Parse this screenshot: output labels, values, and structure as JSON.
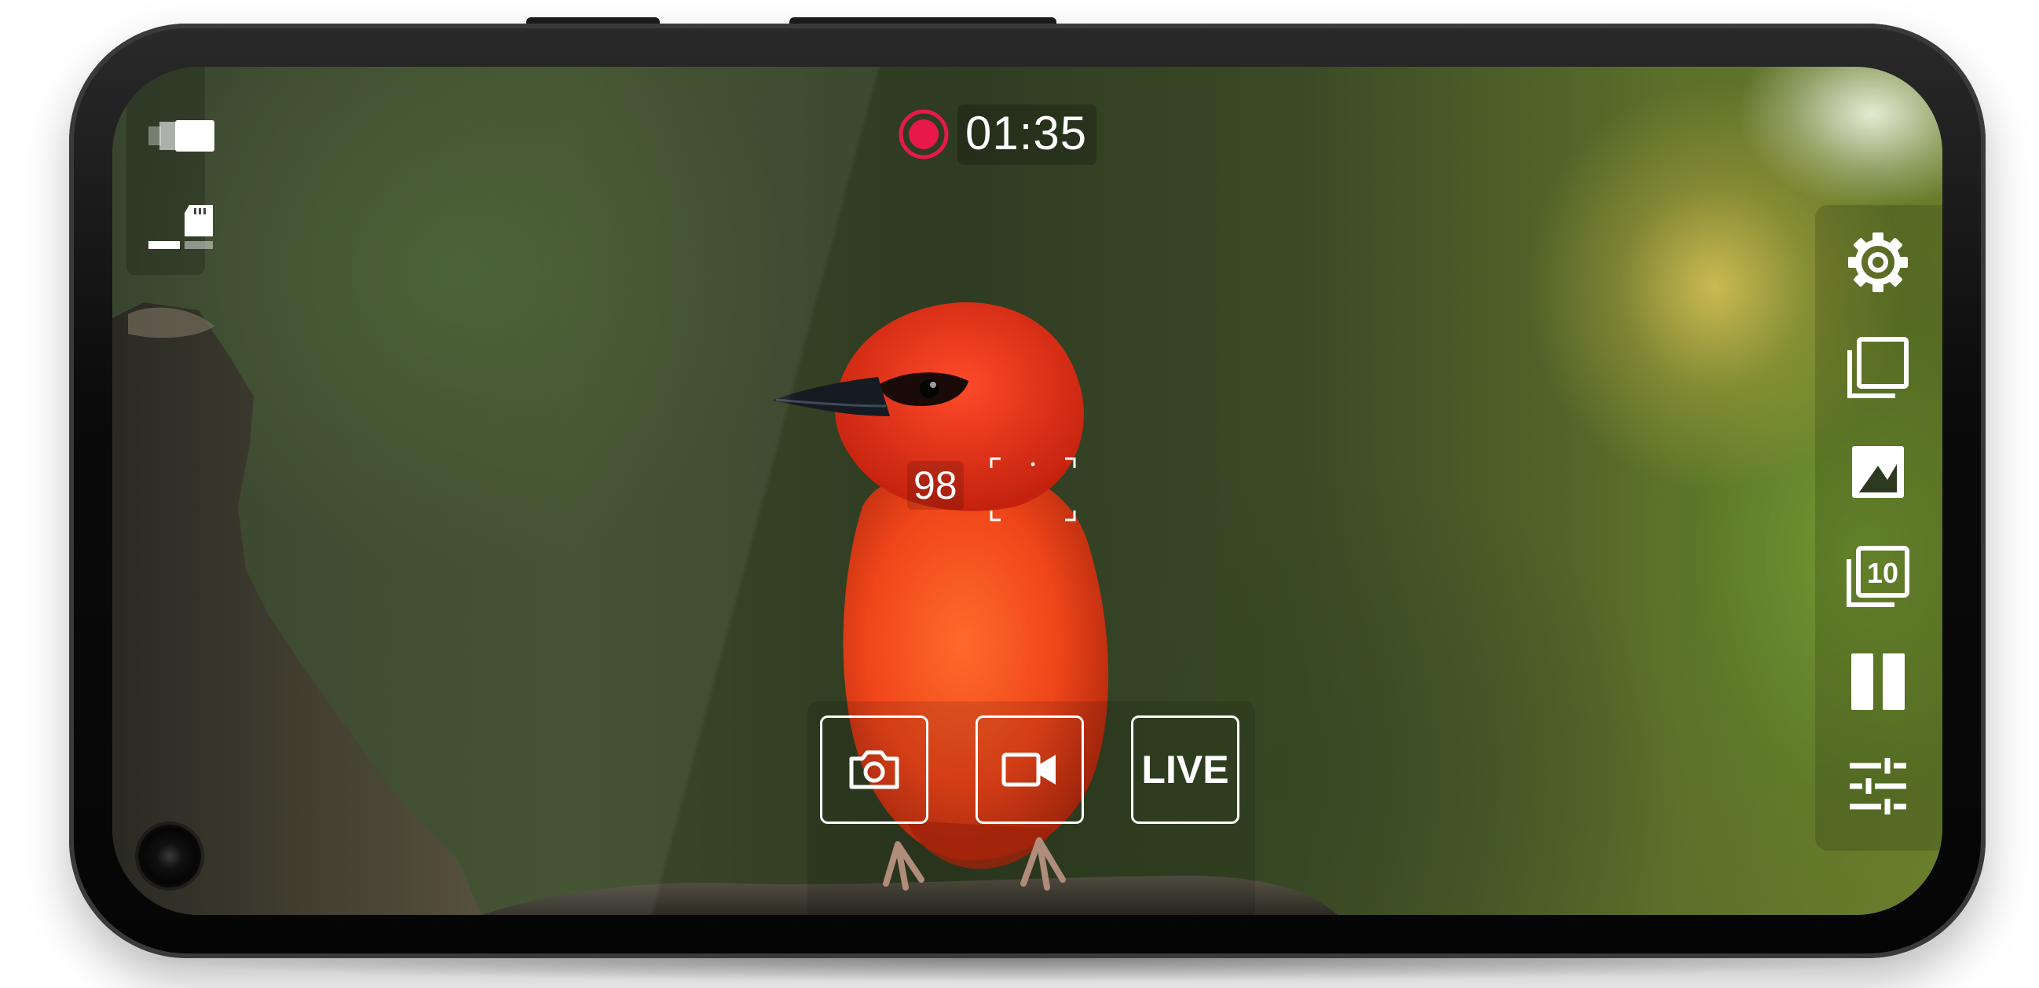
{
  "recording": {
    "state_icon": "record-icon",
    "elapsed_time": "01:35",
    "indicator_color": "#e8194a"
  },
  "status": {
    "icons": [
      "battery-icon",
      "sd-card-storage-icon"
    ]
  },
  "focus": {
    "value": "98",
    "frame_icon": "focus-frame-icon"
  },
  "mode_selector": {
    "photo_icon": "camera-icon",
    "video_icon": "video-camera-icon",
    "live_label": "LIVE"
  },
  "toolbar": {
    "items": [
      "gear-icon",
      "overlay-layers-icon",
      "exposure-icon",
      "burst-10-icon",
      "pause-icon",
      "sliders-icon"
    ]
  },
  "colors": {
    "ui_foreground": "#ffffff",
    "record_accent": "#e8194a",
    "bird": "#f0461a",
    "phone_frame": "#0b0b0b"
  }
}
